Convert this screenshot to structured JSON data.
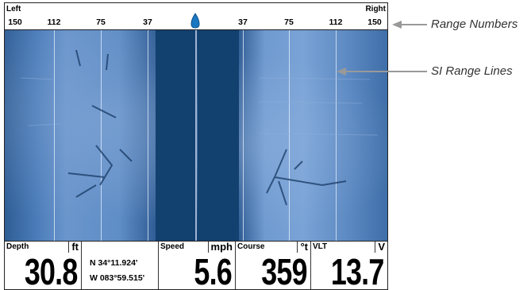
{
  "range_bar": {
    "left_label": "Left",
    "right_label": "Right",
    "numbers": [
      "150",
      "112",
      "75",
      "37",
      "37",
      "75",
      "112",
      "150"
    ]
  },
  "readouts": {
    "depth": {
      "label": "Depth",
      "unit": "ft",
      "value": "30.8"
    },
    "gps": {
      "lat": "N 34°11.924'",
      "lon": "W 083°59.515'"
    },
    "speed": {
      "label": "Speed",
      "unit": "mph",
      "value": "5.6"
    },
    "course": {
      "label": "Course",
      "unit": "°t",
      "value": "359"
    },
    "voltage": {
      "label": "VLT",
      "unit": "V",
      "value": "13.7"
    }
  },
  "callouts": {
    "range_numbers": "Range Numbers",
    "si_range_lines": "SI Range Lines"
  },
  "colors": {
    "sonar_water": "#12406f",
    "sonar_bottom": "#6a95cc",
    "boat_icon": "#1a78c2"
  }
}
